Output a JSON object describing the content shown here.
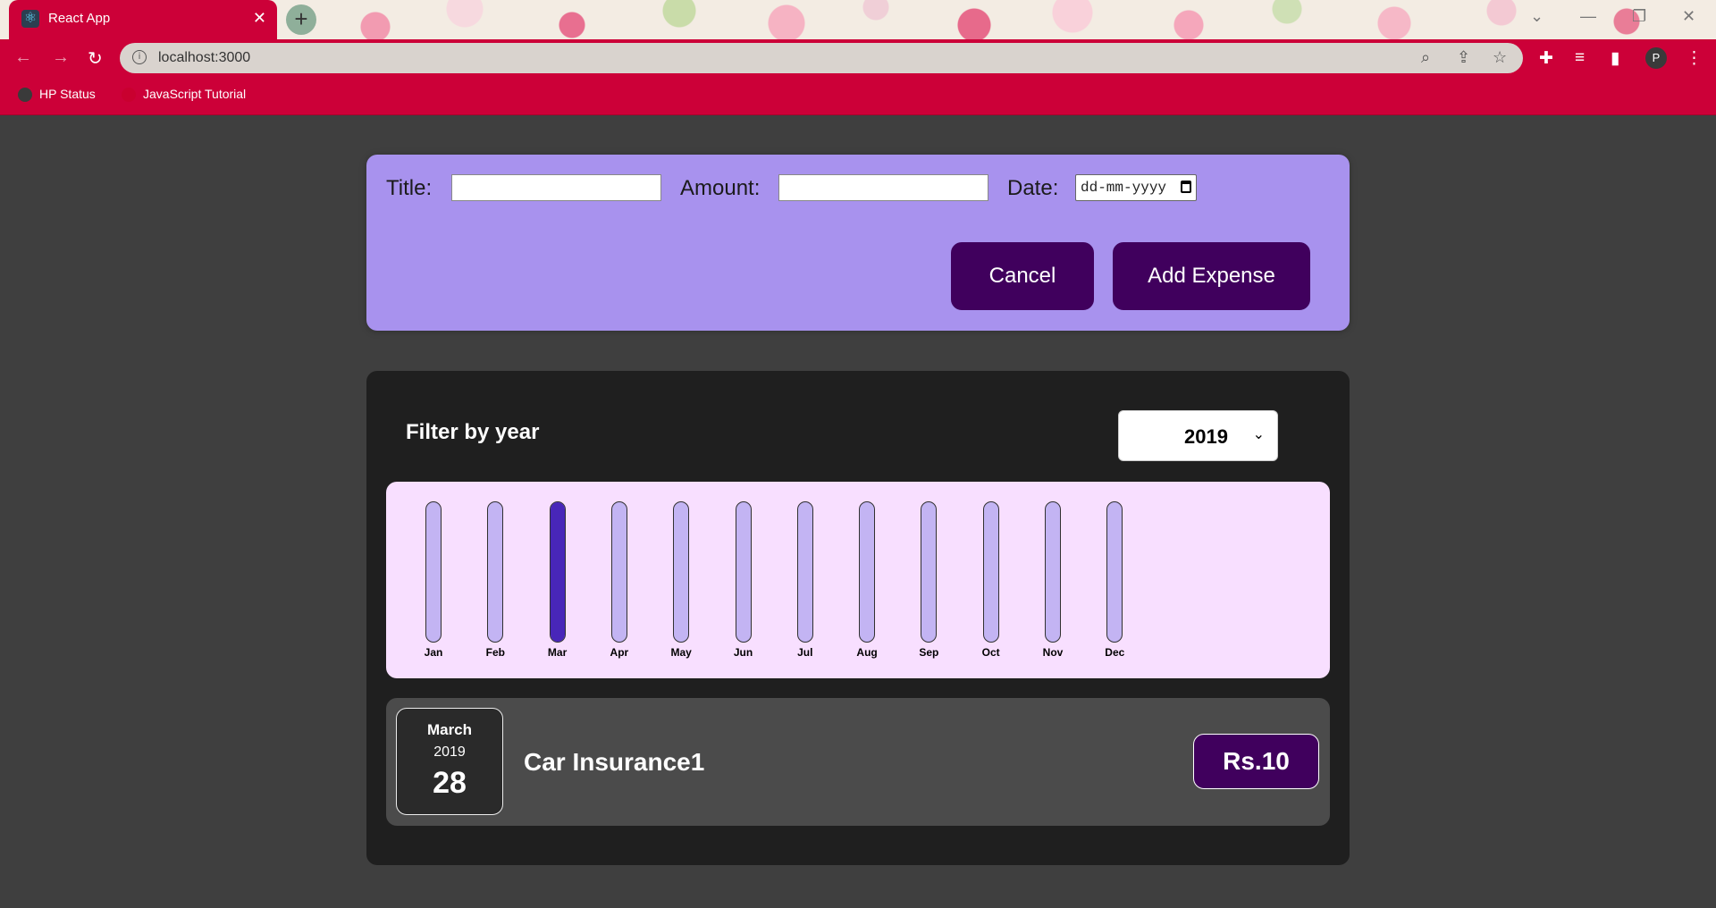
{
  "browser": {
    "tab_title": "React App",
    "url": "localhost:3000",
    "profile_initial": "P",
    "bookmarks": [
      {
        "label": "HP Status"
      },
      {
        "label": "JavaScript Tutorial"
      }
    ],
    "icons": {
      "tab_favicon": "react-icon",
      "close": "close-icon",
      "new_tab": "plus-icon",
      "back": "back-arrow-icon",
      "forward": "forward-arrow-icon",
      "reload": "reload-icon",
      "site_info": "info-icon",
      "zoom": "zoom-icon",
      "share": "share-icon",
      "bookmark_star": "star-icon",
      "extensions": "puzzle-icon",
      "media": "playlist-icon",
      "side_panel": "side-panel-icon",
      "menu": "kebab-menu-icon"
    },
    "accent_color": "#cc0038"
  },
  "form": {
    "title_label": "Title:",
    "title_value": "",
    "amount_label": "Amount:",
    "amount_value": "",
    "date_label": "Date:",
    "date_placeholder": "dd-mm-yyyy",
    "cancel_label": "Cancel",
    "add_label": "Add Expense",
    "background_color": "#a892ee",
    "button_color": "#40005d"
  },
  "filter": {
    "label": "Filter by year",
    "selected_year": "2019"
  },
  "chart": {
    "fill_color": "#4826b9",
    "track_color": "#c3b4f3"
  },
  "chart_data": {
    "type": "bar",
    "categories": [
      "Jan",
      "Feb",
      "Mar",
      "Apr",
      "May",
      "Jun",
      "Jul",
      "Aug",
      "Sep",
      "Oct",
      "Nov",
      "Dec"
    ],
    "values": [
      0,
      0,
      10,
      0,
      0,
      0,
      0,
      0,
      0,
      0,
      0,
      0
    ],
    "ylim": [
      0,
      10
    ]
  },
  "expenses": [
    {
      "month": "March",
      "year": "2019",
      "day": "28",
      "title": "Car Insurance1",
      "amount": "Rs.10"
    }
  ]
}
